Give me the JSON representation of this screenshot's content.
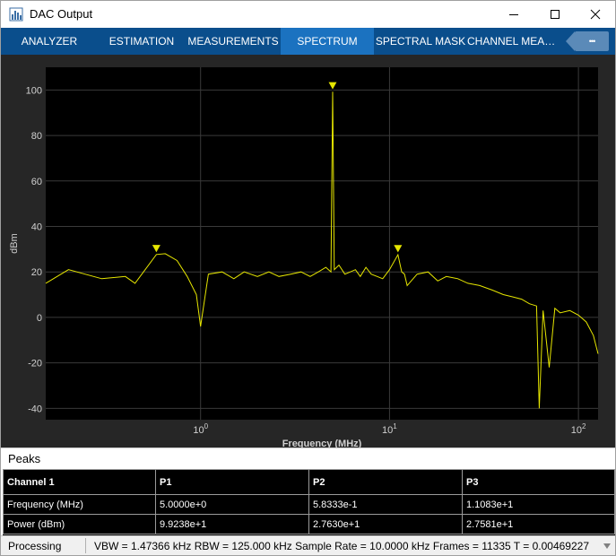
{
  "window": {
    "title": "DAC Output",
    "icons": [
      "app-icon",
      "minimize-icon",
      "maximize-icon",
      "close-icon"
    ]
  },
  "tabs": [
    {
      "label": "ANALYZER",
      "active": false
    },
    {
      "label": "ESTIMATION",
      "active": false
    },
    {
      "label": "MEASUREMENTS",
      "active": false
    },
    {
      "label": "SPECTRUM",
      "active": true
    },
    {
      "label": "SPECTRAL MASK",
      "active": false
    },
    {
      "label": "CHANNEL MEA…",
      "active": false
    }
  ],
  "tab_overflow": {
    "icon": "more-icon",
    "label": "•••"
  },
  "chart_data": {
    "type": "line",
    "title": "",
    "xlabel": "Frequency (MHz)",
    "ylabel": "dBm",
    "xscale": "log",
    "xlim": [
      0.1515,
      1.27
    ],
    "ylim": [
      -45,
      110
    ],
    "xticks": [
      {
        "value": 1,
        "base": "10",
        "exp": "0"
      },
      {
        "value": 10,
        "base": "10",
        "exp": "1"
      },
      {
        "value": 100,
        "base": "10",
        "exp": "2"
      }
    ],
    "yticks": [
      -40,
      -20,
      0,
      20,
      40,
      60,
      80,
      100
    ],
    "grid": true,
    "line_color": "#e6e600",
    "series": [
      {
        "x": [
          0.1515,
          0.2,
          0.3,
          0.4,
          0.45,
          0.5833,
          0.65,
          0.75,
          0.85,
          0.95,
          1.0,
          1.1,
          1.3,
          1.5,
          1.7,
          2.0,
          2.3,
          2.6,
          3.0,
          3.4,
          3.8,
          4.2,
          4.6,
          4.9,
          5.0,
          5.1,
          5.4,
          5.8,
          6.2,
          6.6,
          7.0,
          7.5,
          8.0,
          8.6,
          9.2,
          10.0,
          11.083,
          11.6,
          12.0,
          12.4,
          14.0,
          16.0,
          18.0,
          20.0,
          23.0,
          26.0,
          30.0,
          35.0,
          40.0,
          45.0,
          50.0,
          55.0,
          60.0,
          62.0,
          65.0,
          70.0,
          75.0,
          80.0,
          90.0,
          100.0,
          110.0,
          120.0,
          127.0
        ],
        "y": [
          15,
          21,
          17,
          18,
          15,
          27.63,
          28,
          25,
          18,
          10,
          -4,
          19,
          20,
          17,
          20,
          18,
          20,
          18,
          19,
          20,
          18,
          20,
          22,
          20,
          99.24,
          21,
          23,
          19,
          20,
          21,
          18,
          22,
          19,
          18,
          17,
          21,
          27.58,
          20,
          19,
          14,
          19,
          20,
          16,
          18,
          17,
          15,
          14,
          12,
          10,
          9,
          8,
          6,
          5,
          -40,
          3,
          -22,
          4,
          2,
          3,
          1,
          -2,
          -8,
          -16
        ]
      }
    ],
    "peak_markers": [
      {
        "x": 5.0,
        "y": 99.238
      },
      {
        "x": 0.58333,
        "y": 27.63
      },
      {
        "x": 11.083,
        "y": 27.581
      }
    ]
  },
  "peaks": {
    "title": "Peaks",
    "columns": [
      "Channel 1",
      "P1",
      "P2",
      "P3"
    ],
    "rows": [
      [
        "Frequency (MHz)",
        "5.0000e+0",
        "5.8333e-1",
        "1.1083e+1"
      ],
      [
        "Power (dBm)",
        "9.9238e+1",
        "2.7630e+1",
        "2.7581e+1"
      ]
    ]
  },
  "status": {
    "state": "Processing",
    "info": "VBW = 1.47366 kHz  RBW = 125.000 kHz  Sample Rate = 10.0000 kHz  Frames = 11335  T = 0.00469227"
  }
}
